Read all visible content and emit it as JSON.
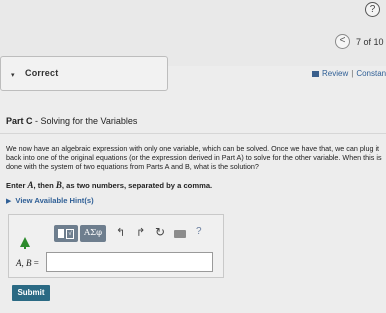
{
  "header": {
    "help_glyph": "?",
    "pager_prev_glyph": "<",
    "pager_text": "7 of 10",
    "review_label": "Review",
    "separator": "|",
    "constants_label": "Constan"
  },
  "correct_panel": {
    "chevron_glyph": "▾",
    "label": "Correct"
  },
  "part": {
    "label": "Part C",
    "title": " - Solving for the Variables"
  },
  "body": {
    "paragraph": "We now have an algebraic expression with only one variable, which can be solved. Once we have that, we can plug it back into one of the original equations (or the expression derived in Part A) to solve for the other variable. When this is done with the system of two equations from Parts A and B, what is the solution?",
    "instruction_prefix": "Enter ",
    "var_a": "A",
    "instruction_mid": ", then ",
    "var_b": "B",
    "instruction_suffix": ", as two numbers, separated by a comma."
  },
  "hints": {
    "label": "View Available Hint(s)"
  },
  "toolbar": {
    "templates_glyph": "√",
    "symbols_label": "ΑΣφ",
    "undo_glyph": "↰",
    "redo_glyph": "↱",
    "reset_glyph": "↻",
    "help_glyph": "?"
  },
  "answer": {
    "label_vars": "A, B",
    "label_eq": " =",
    "value": ""
  },
  "submit": {
    "label": "Submit"
  },
  "colors": {
    "accent": "#2b6a84",
    "link": "#2f5f96",
    "toolbar_button": "#6e7e8e"
  }
}
